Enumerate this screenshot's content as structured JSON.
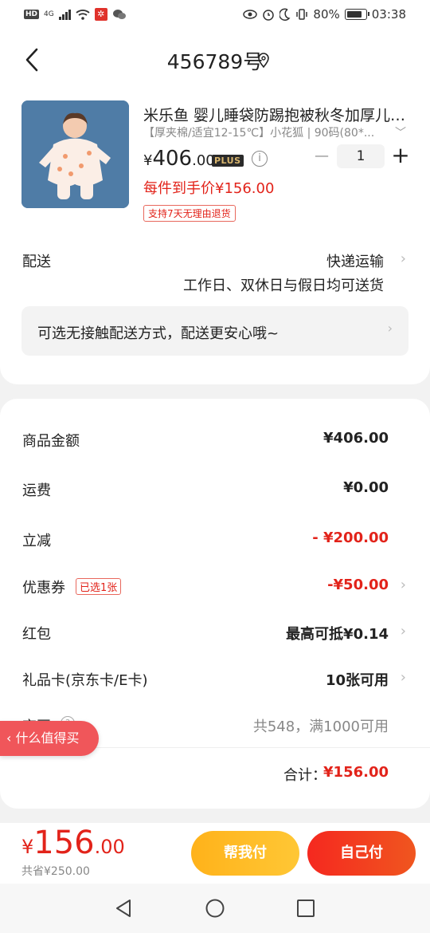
{
  "status_bar": {
    "hd": "HD",
    "network": "4G",
    "battery": "80%",
    "time": "03:38"
  },
  "header": {
    "title": "456789号"
  },
  "product": {
    "title": "米乐鱼 婴儿睡袋防踢抱被秋冬加厚儿童睡袋宝宝",
    "spec": "【厚夹棉/适宜12-15℃】小花狐 | 90码(80*...",
    "price_symbol": "¥",
    "price_int": "406",
    "price_dec": ".00",
    "plus_badge": "PLUS",
    "quantity": "1",
    "hand_price": "每件到手价¥156.00",
    "return_tag": "支持7天无理由退货"
  },
  "delivery": {
    "label": "配送",
    "method": "快递运输",
    "note": "工作日、双休日与假日均可送货",
    "contactless": "可选无接触配送方式，配送更安心哦~"
  },
  "costs": {
    "goods_amount_label": "商品金额",
    "goods_amount": "¥406.00",
    "shipping_label": "运费",
    "shipping": "¥0.00",
    "discount_label": "立减",
    "discount": "- ¥200.00",
    "coupon_label": "优惠券",
    "coupon_tag": "已选1张",
    "coupon": "-¥50.00",
    "red_packet_label": "红包",
    "red_packet": "最高可抵¥0.14",
    "gift_card_label": "礼品卡(京东卡/E卡)",
    "gift_card": "10张可用",
    "jd_bean_label": "京豆",
    "jd_bean": "共548，满1000可用",
    "total_label": "合计：",
    "total": "¥156.00"
  },
  "float_tag": "什么值得买",
  "bottom": {
    "pay_symbol": "¥",
    "pay_int": "156",
    "pay_dec": ".00",
    "saved": "共省¥250.00",
    "help_pay": "帮我付",
    "self_pay": "自己付"
  },
  "colors": {
    "accent_red": "#e2231a",
    "help_pay": "#ffb21a",
    "self_pay": "#f5281f"
  }
}
